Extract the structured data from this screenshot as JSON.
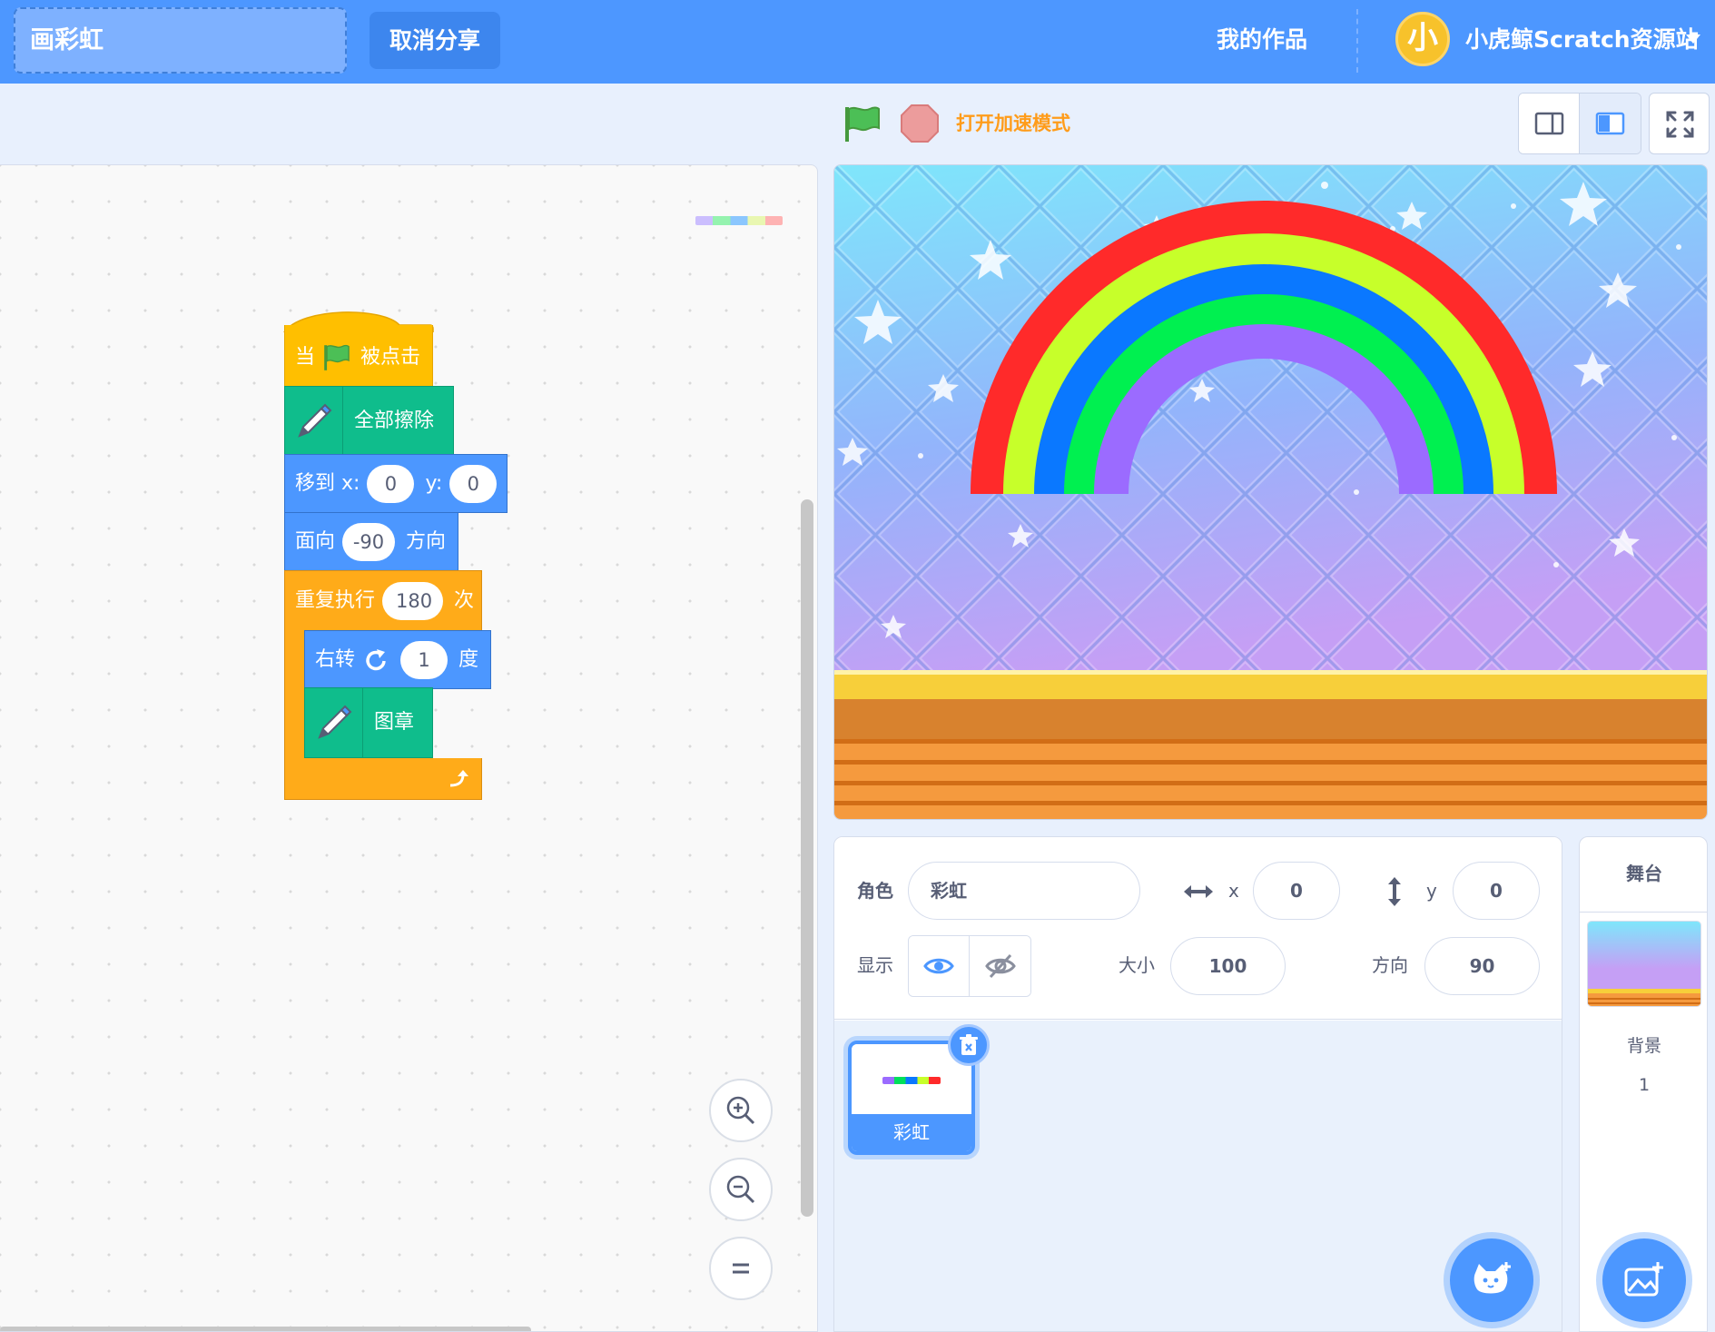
{
  "header": {
    "project_title": "画彩虹",
    "unshare_label": "取消分享",
    "my_works_label": "我的作品",
    "avatar_char": "小",
    "site_name": "小虎鲸Scratch资源站"
  },
  "controls": {
    "turbo_label": "打开加速模式",
    "icons": [
      "green-flag-icon",
      "stop-icon",
      "small-stage-icon",
      "large-stage-icon",
      "fullscreen-icon"
    ]
  },
  "script": {
    "when_label": "当",
    "clicked_label": "被点击",
    "erase_all_label": "全部擦除",
    "goto_label": "移到 x:",
    "goto_x": "0",
    "goto_y_label": "y:",
    "goto_y": "0",
    "point_label": "面向",
    "point_value": "-90",
    "direction_label": "方向",
    "repeat_label": "重复执行",
    "repeat_count": "180",
    "times_label": "次",
    "turn_label": "右转",
    "turn_value": "1",
    "degrees_label": "度",
    "stamp_label": "图章"
  },
  "sprite_info": {
    "sprite_label": "角色",
    "sprite_name": "彩虹",
    "x_label": "x",
    "x_value": "0",
    "y_label": "y",
    "y_value": "0",
    "show_label": "显示",
    "size_label": "大小",
    "size_value": "100",
    "direction_label": "方向",
    "direction_value": "90"
  },
  "sprites": [
    {
      "name": "彩虹",
      "selected": true
    }
  ],
  "stage_panel": {
    "title": "舞台",
    "backdrop_label": "背景",
    "backdrop_count": "1"
  },
  "colors": {
    "menu_blue": "#4d97ff",
    "events": "#ffbf00",
    "pen": "#0fbd8c",
    "motion": "#4c97ff",
    "control": "#ffab19",
    "rainbow": [
      "#ff2a2a",
      "#c7ff2a",
      "#0a78ff",
      "#00f050",
      "#9b6bff"
    ]
  }
}
